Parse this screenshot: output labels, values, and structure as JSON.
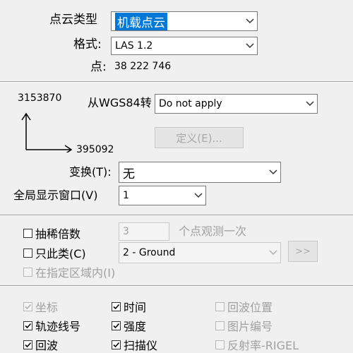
{
  "top": {
    "cloud_type_label": "点云类型",
    "cloud_type_value": "机载点云",
    "format_label": "格式:",
    "format_value": "LAS 1.2",
    "points_label": "点:",
    "points_value": "38 222 746"
  },
  "coords": {
    "y_value": "3153870",
    "x_value": "395092",
    "wgs_label": "从WGS84转",
    "wgs_value": "Do not apply",
    "define_button": "定义(E)...",
    "transform_label": "变换(T):",
    "transform_value": "无",
    "global_window_label": "全局显示窗口(V)",
    "global_window_value": "1"
  },
  "filter": {
    "thin_label": "抽稀倍数",
    "thin_value": "3",
    "thin_suffix": "个点观测一次",
    "class_only_label": "只此类(C)",
    "class_value": "2 - Ground",
    "class_button": ">>",
    "region_label": "在指定区域内(I)"
  },
  "attributes": {
    "coord": "坐标",
    "time": "时间",
    "echo_pos": "回波位置",
    "line_no": "轨迹线号",
    "intensity": "强度",
    "image_no": "图片编号",
    "echo": "回波",
    "scanner": "扫描仪",
    "reflect": "反射率-RIGEL"
  }
}
